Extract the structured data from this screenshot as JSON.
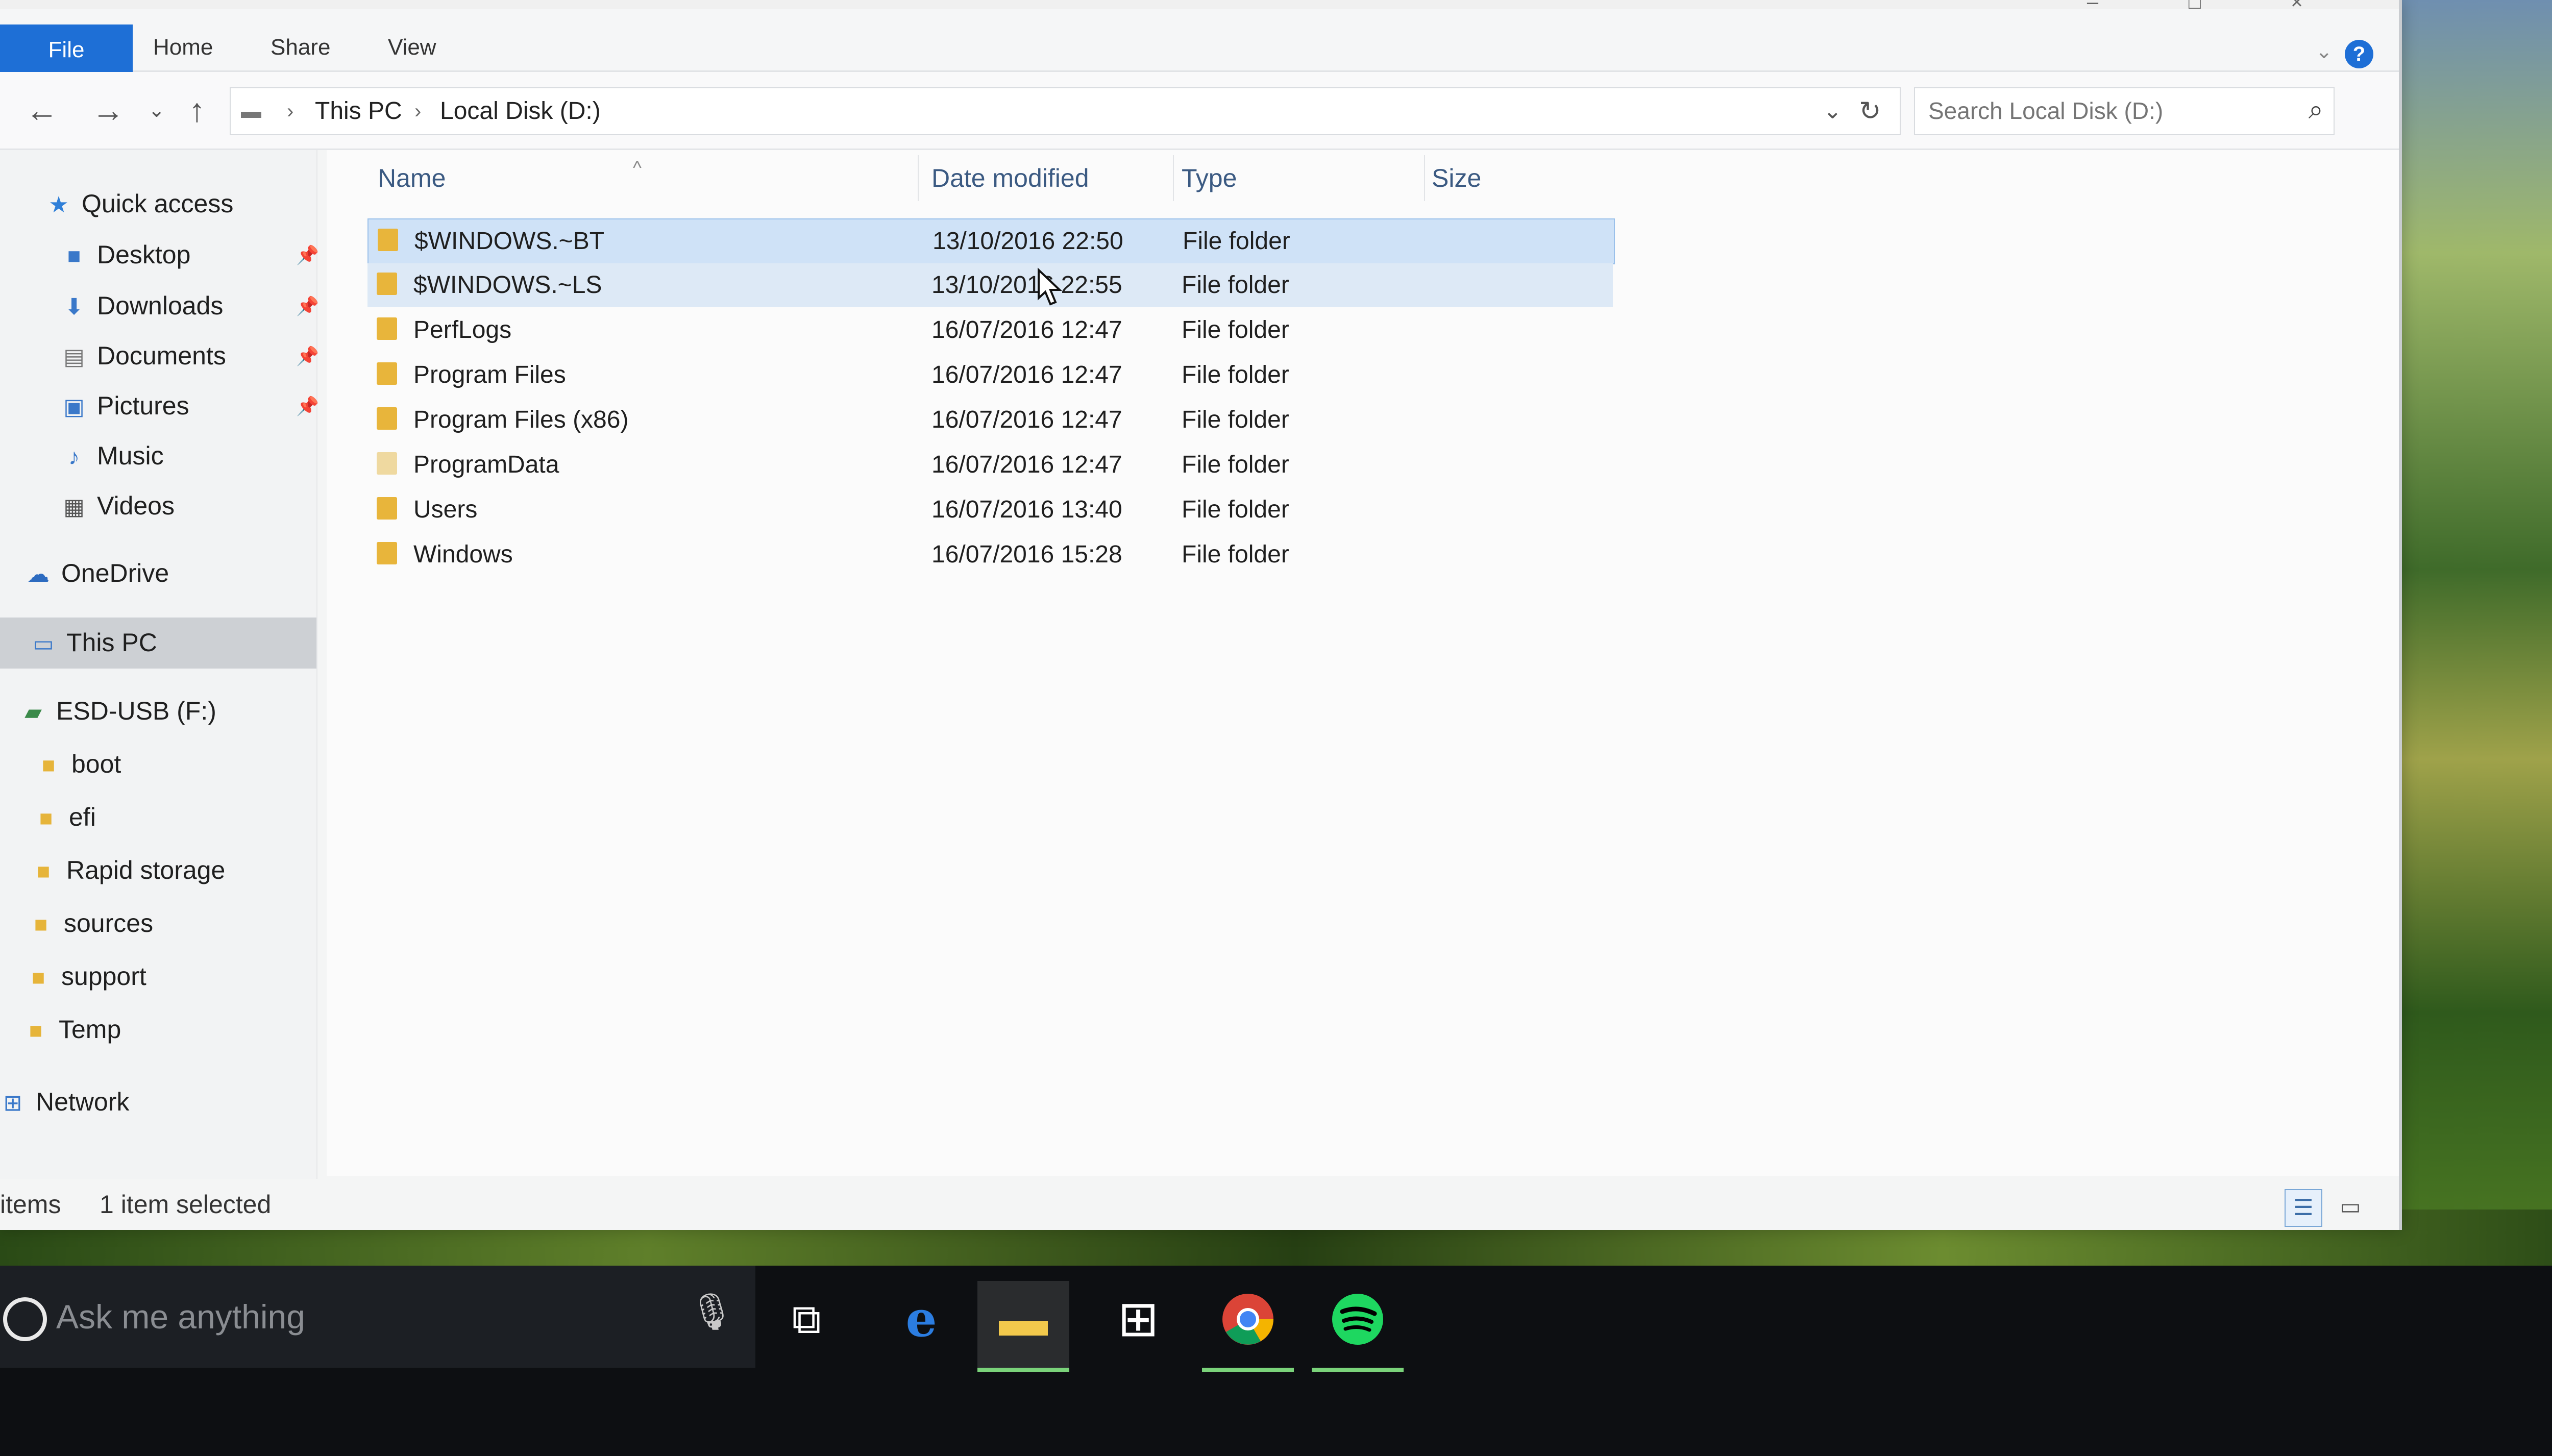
{
  "window": {
    "title": "Local Disk (D:)"
  },
  "ribbon": {
    "tabs": [
      "File",
      "Home",
      "Share",
      "View"
    ],
    "help": "?"
  },
  "address": {
    "crumbs": [
      "This PC",
      "Local Disk (D:)"
    ],
    "search_placeholder": "Search Local Disk (D:)"
  },
  "sidebar": {
    "quick_access": "Quick access",
    "quick_items": [
      "Desktop",
      "Downloads",
      "Documents",
      "Pictures",
      "Music",
      "Videos"
    ],
    "onedrive": "OneDrive",
    "thispc": "This PC",
    "usb": "ESD-USB (F:)",
    "usb_items": [
      "boot",
      "efi",
      "Rapid storage",
      "sources",
      "support",
      "Temp"
    ],
    "network": "Network"
  },
  "columns": [
    "Name",
    "Date modified",
    "Type",
    "Size"
  ],
  "files": [
    {
      "name": "$WINDOWS.~BT",
      "date": "13/10/2016 22:50",
      "type": "File folder"
    },
    {
      "name": "$WINDOWS.~LS",
      "date": "13/10/2016 22:55",
      "type": "File folder"
    },
    {
      "name": "PerfLogs",
      "date": "16/07/2016 12:47",
      "type": "File folder"
    },
    {
      "name": "Program Files",
      "date": "16/07/2016 12:47",
      "type": "File folder"
    },
    {
      "name": "Program Files (x86)",
      "date": "16/07/2016 12:47",
      "type": "File folder"
    },
    {
      "name": "ProgramData",
      "date": "16/07/2016 12:47",
      "type": "File folder"
    },
    {
      "name": "Users",
      "date": "16/07/2016 13:40",
      "type": "File folder"
    },
    {
      "name": "Windows",
      "date": "16/07/2016 15:28",
      "type": "File folder"
    }
  ],
  "status": {
    "items": "items",
    "selected": "1 item selected"
  },
  "taskbar": {
    "search_text": "Ask me anything",
    "apps": [
      "task-view",
      "edge",
      "file-explorer",
      "store",
      "chrome",
      "spotify"
    ]
  },
  "colors": {
    "accent": "#1e6fd6",
    "selection": "#cfe2f7",
    "folder": "#e8b53b"
  }
}
